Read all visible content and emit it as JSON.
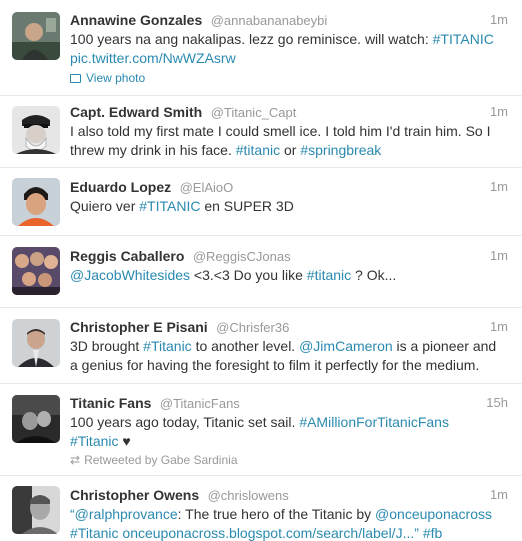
{
  "tweets": [
    {
      "name": "Annawine Gonzales",
      "handle": "@annabananabeybi",
      "time": "1m",
      "text": [
        "100 years na ang nakalipas. lezz go reminisce. will watch: ",
        "#TITANIC"
      ],
      "text2": "pic.twitter.com/NwWZAsrw",
      "photo_label": "View photo"
    },
    {
      "name": "Capt. Edward Smith",
      "handle": "@Titanic_Capt",
      "time": "1m",
      "line1": "I also told my first mate I could smell ice. I told him I'd train him. So I",
      "line2": [
        "threw my drink in his face. ",
        "#titanic",
        " or ",
        "#springbreak"
      ]
    },
    {
      "name": "Eduardo Lopez",
      "handle": "@ElAioO",
      "time": "1m",
      "text": [
        "Quiero ver ",
        "#TITANIC",
        " en SUPER 3D"
      ]
    },
    {
      "name": "Reggis Caballero",
      "handle": "@ReggisCJonas",
      "time": "1m",
      "text": [
        "@JacobWhitesides",
        " <3.<3 Do you like ",
        "#titanic",
        " ? Ok..."
      ]
    },
    {
      "name": "Christopher E Pisani",
      "handle": "@Chrisfer36",
      "time": "1m",
      "line1": [
        "3D brought ",
        "#Titanic",
        " to another level. ",
        "@JimCameron",
        " is a pioneer and"
      ],
      "line2": "a genius for having the foresight to film it perfectly for the medium."
    },
    {
      "name": "Titanic Fans",
      "handle": "@TitanicFans",
      "time": "15h",
      "line1": [
        "100 years ago today, Titanic set sail. ",
        "#AMillionForTitanicFans"
      ],
      "line2": [
        "#Titanic",
        " ♥"
      ],
      "retweet_label": "Retweeted by Gabe Sardinia"
    },
    {
      "name": "Christopher Owens",
      "handle": "@chrislowens",
      "time": "1m",
      "line1": [
        "“",
        "@ralphprovance",
        ": The true hero of the Titanic by ",
        "@onceuponacross"
      ],
      "line2": [
        "#Titanic",
        " ",
        "onceuponacross.blogspot.com/search/label/J...",
        "” ",
        "#fb"
      ]
    }
  ],
  "colors": {
    "link": "#2a8ab0",
    "text": "#333333",
    "muted": "#999999",
    "divider": "#e8e8e8"
  }
}
